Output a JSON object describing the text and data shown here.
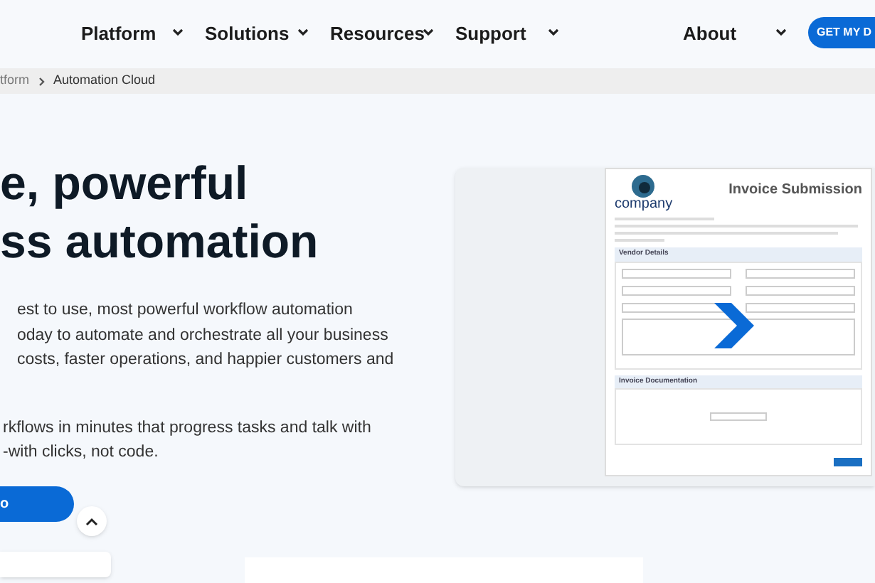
{
  "nav": {
    "items": [
      {
        "label": "Platform"
      },
      {
        "label": "Solutions"
      },
      {
        "label": "Resources"
      },
      {
        "label": "Support"
      },
      {
        "label": "About"
      }
    ],
    "cta": "GET MY D"
  },
  "breadcrumb": [
    "tform",
    "Automation Cloud"
  ],
  "hero": {
    "heading": [
      "e, powerful",
      "ss automation"
    ],
    "paragraphs": [
      [
        "est to use, most powerful workflow automation",
        "oday to automate and orchestrate all your business",
        "costs, faster operations, and happier customers and"
      ],
      [
        "rkflows in minutes that progress tasks and talk with",
        "-with clicks, not code."
      ]
    ],
    "button": "o"
  },
  "form_preview": {
    "logo": "company",
    "title": "Invoice Submission",
    "sections": [
      "Vendor Details",
      "Invoice Documentation"
    ]
  }
}
